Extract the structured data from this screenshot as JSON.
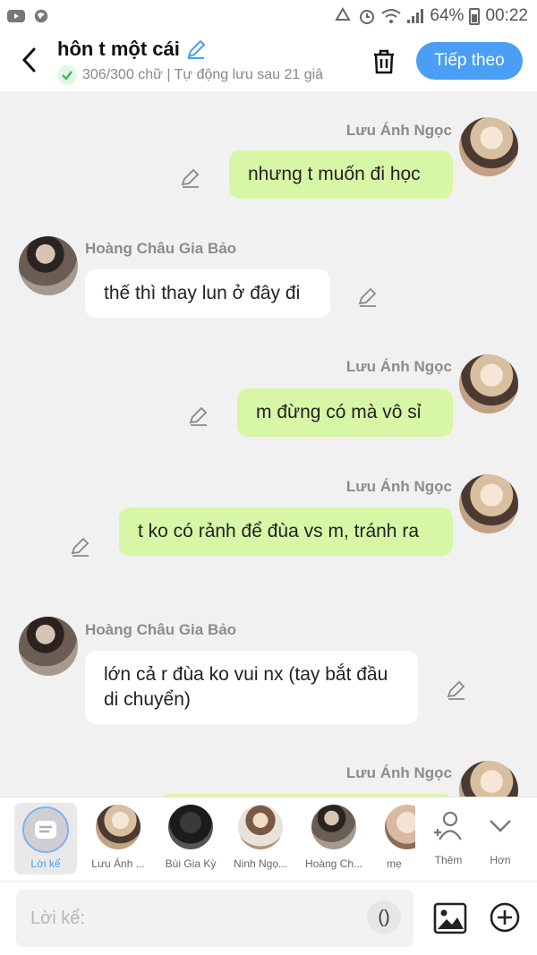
{
  "status_bar": {
    "battery": "64%",
    "time": "00:22"
  },
  "header": {
    "title": "hôn t một cái",
    "subtitle": "306/300 chữ | Tự động lưu sau 21 giâ",
    "next_label": "Tiếp theo"
  },
  "messages": [
    {
      "sender": "Lưu Ánh Ngọc",
      "side": "right",
      "text": "nhưng t muốn đi học"
    },
    {
      "sender": "Hoàng Châu Gia Bảo",
      "side": "left",
      "text": "thế thì thay lun ở đây đi"
    },
    {
      "sender": "Lưu Ánh Ngọc",
      "side": "right",
      "text": "m đừng có mà vô sỉ"
    },
    {
      "sender": "Lưu Ánh Ngọc",
      "side": "right",
      "text": "t ko có rảnh để đùa vs m, tránh ra"
    },
    {
      "sender": "Hoàng Châu Gia Bảo",
      "side": "left",
      "text": "lớn cả r đùa ko vui nx (tay bắt đầu di chuyển)"
    },
    {
      "sender": "Lưu Ánh Ngọc",
      "side": "right",
      "text": ""
    }
  ],
  "characters": {
    "narrator_label": "Lời kể",
    "items": [
      {
        "name": "Lưu Ánh ..."
      },
      {
        "name": "Bùi Gia Kỳ"
      },
      {
        "name": "Ninh Ngọ..."
      },
      {
        "name": "Hoàng Ch..."
      },
      {
        "name": "mẹ"
      }
    ],
    "add_label": "Thêm",
    "more_label": "Hơn"
  },
  "input": {
    "placeholder": "Lời kể:",
    "value": "",
    "paren_label": "()"
  },
  "icons": {
    "back": "chevron-left-icon",
    "edit_title": "pencil-icon",
    "trash": "trash-icon",
    "edit_message": "pencil-icon",
    "image": "image-icon",
    "plus": "plus-circle-icon",
    "add_person": "add-person-icon",
    "more": "chevron-down-icon"
  },
  "colors": {
    "accent": "#4a9ff5",
    "my_bubble": "#d8f7a6",
    "their_bubble": "#ffffff",
    "background": "#f1f1f1"
  }
}
